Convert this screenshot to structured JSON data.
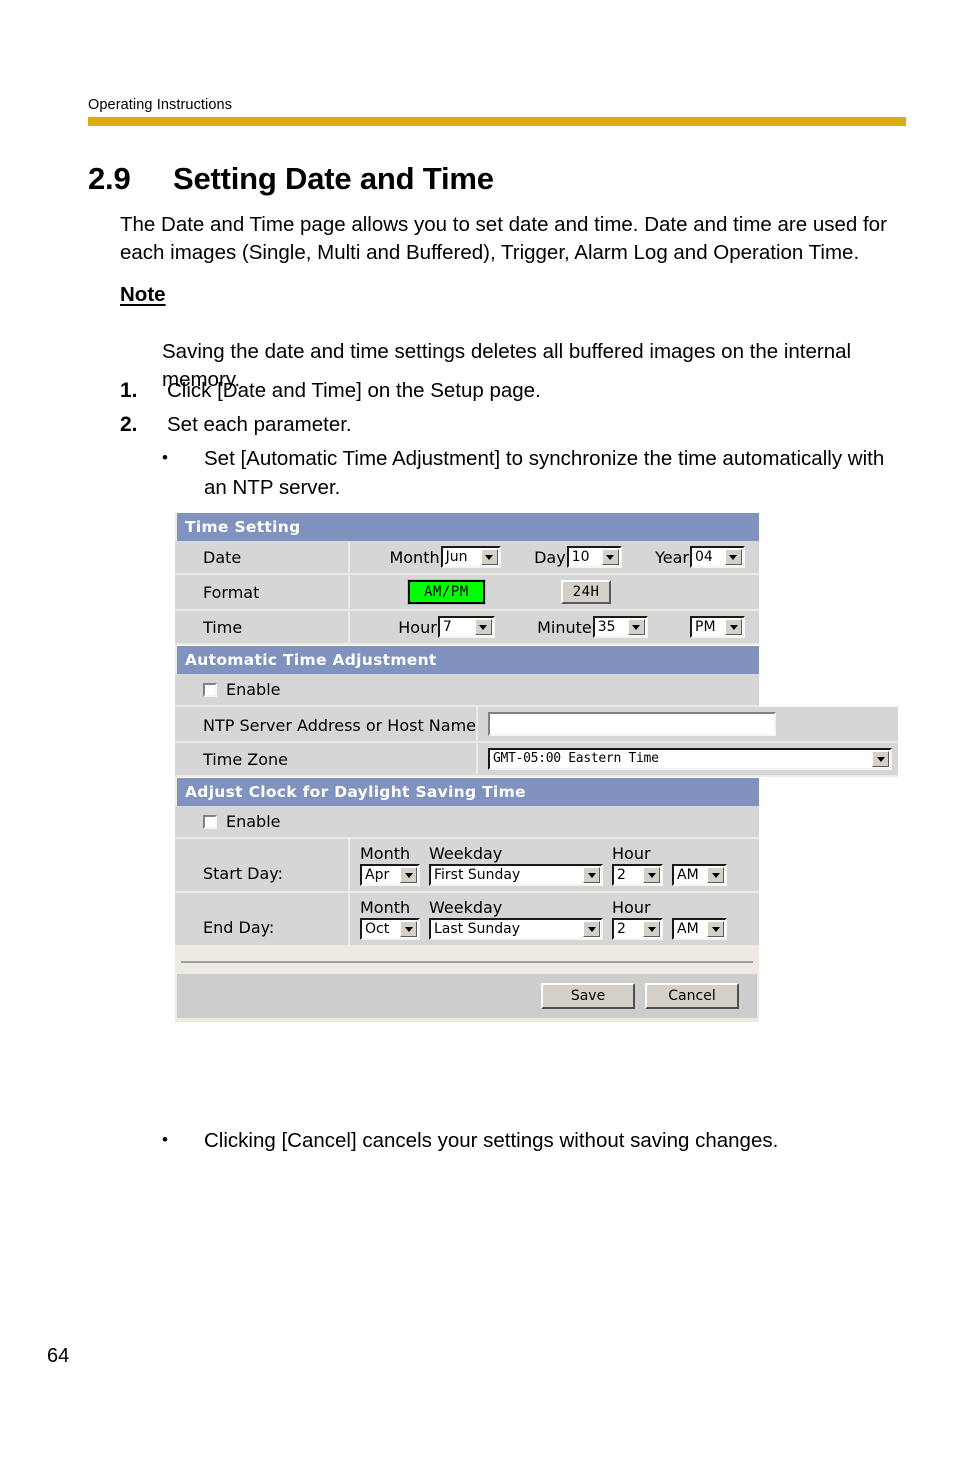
{
  "document": {
    "header_label": "Operating Instructions",
    "rule_color": "#d9ad12",
    "page_number": "64"
  },
  "section": {
    "number": "2.9",
    "title": "Setting Date and Time",
    "intro": "The Date and Time page allows you to set date and time. Date and time are used for each images (Single, Multi and Buffered), Trigger, Alarm Log and Operation Time.",
    "note_heading": "Note",
    "note_text": "Saving the date and time settings deletes all buffered images on the internal memory.",
    "steps": [
      {
        "marker": "1.",
        "text": "Click [Date and Time] on the Setup page."
      },
      {
        "marker": "2.",
        "text": "Set each parameter."
      }
    ],
    "bullets": [
      {
        "dot": "•",
        "text": "Set [Automatic Time Adjustment] to synchronize the time automatically with an NTP server."
      },
      {
        "dot": "•",
        "text": "Clicking [Cancel] cancels your settings without saving changes."
      }
    ]
  },
  "form": {
    "accent_header_color": "#7f93be",
    "selected_format_color": "#00ff00",
    "time_setting": {
      "title": "Time Setting",
      "date": {
        "label": "Date",
        "month_label": "Month",
        "month_value": "Jun",
        "day_label": "Day",
        "day_value": "10",
        "year_label": "Year",
        "year_value": "04"
      },
      "format": {
        "label": "Format",
        "ampm_button": "AM/PM",
        "h24_button": "24H"
      },
      "time": {
        "label": "Time",
        "hour_label": "Hour",
        "hour_value": "7",
        "minute_label": "Minute",
        "minute_value": "35",
        "ampm_value": "PM"
      }
    },
    "auto_time": {
      "title": "Automatic Time Adjustment",
      "enable_label": "Enable",
      "ntp_label": "NTP Server Address or Host Name",
      "ntp_value": "",
      "timezone_label": "Time Zone",
      "timezone_value": "GMT-05:00 Eastern Time"
    },
    "dst": {
      "title": "Adjust Clock for Daylight Saving Time",
      "enable_label": "Enable",
      "col_month": "Month",
      "col_weekday": "Weekday",
      "col_hour": "Hour",
      "start": {
        "label": "Start Day:",
        "month": "Apr",
        "weekday": "First Sunday",
        "hour": "2",
        "ampm": "AM"
      },
      "end": {
        "label": "End Day:",
        "month": "Oct",
        "weekday": "Last Sunday",
        "hour": "2",
        "ampm": "AM"
      }
    },
    "footer": {
      "save_label": "Save",
      "cancel_label": "Cancel"
    }
  }
}
